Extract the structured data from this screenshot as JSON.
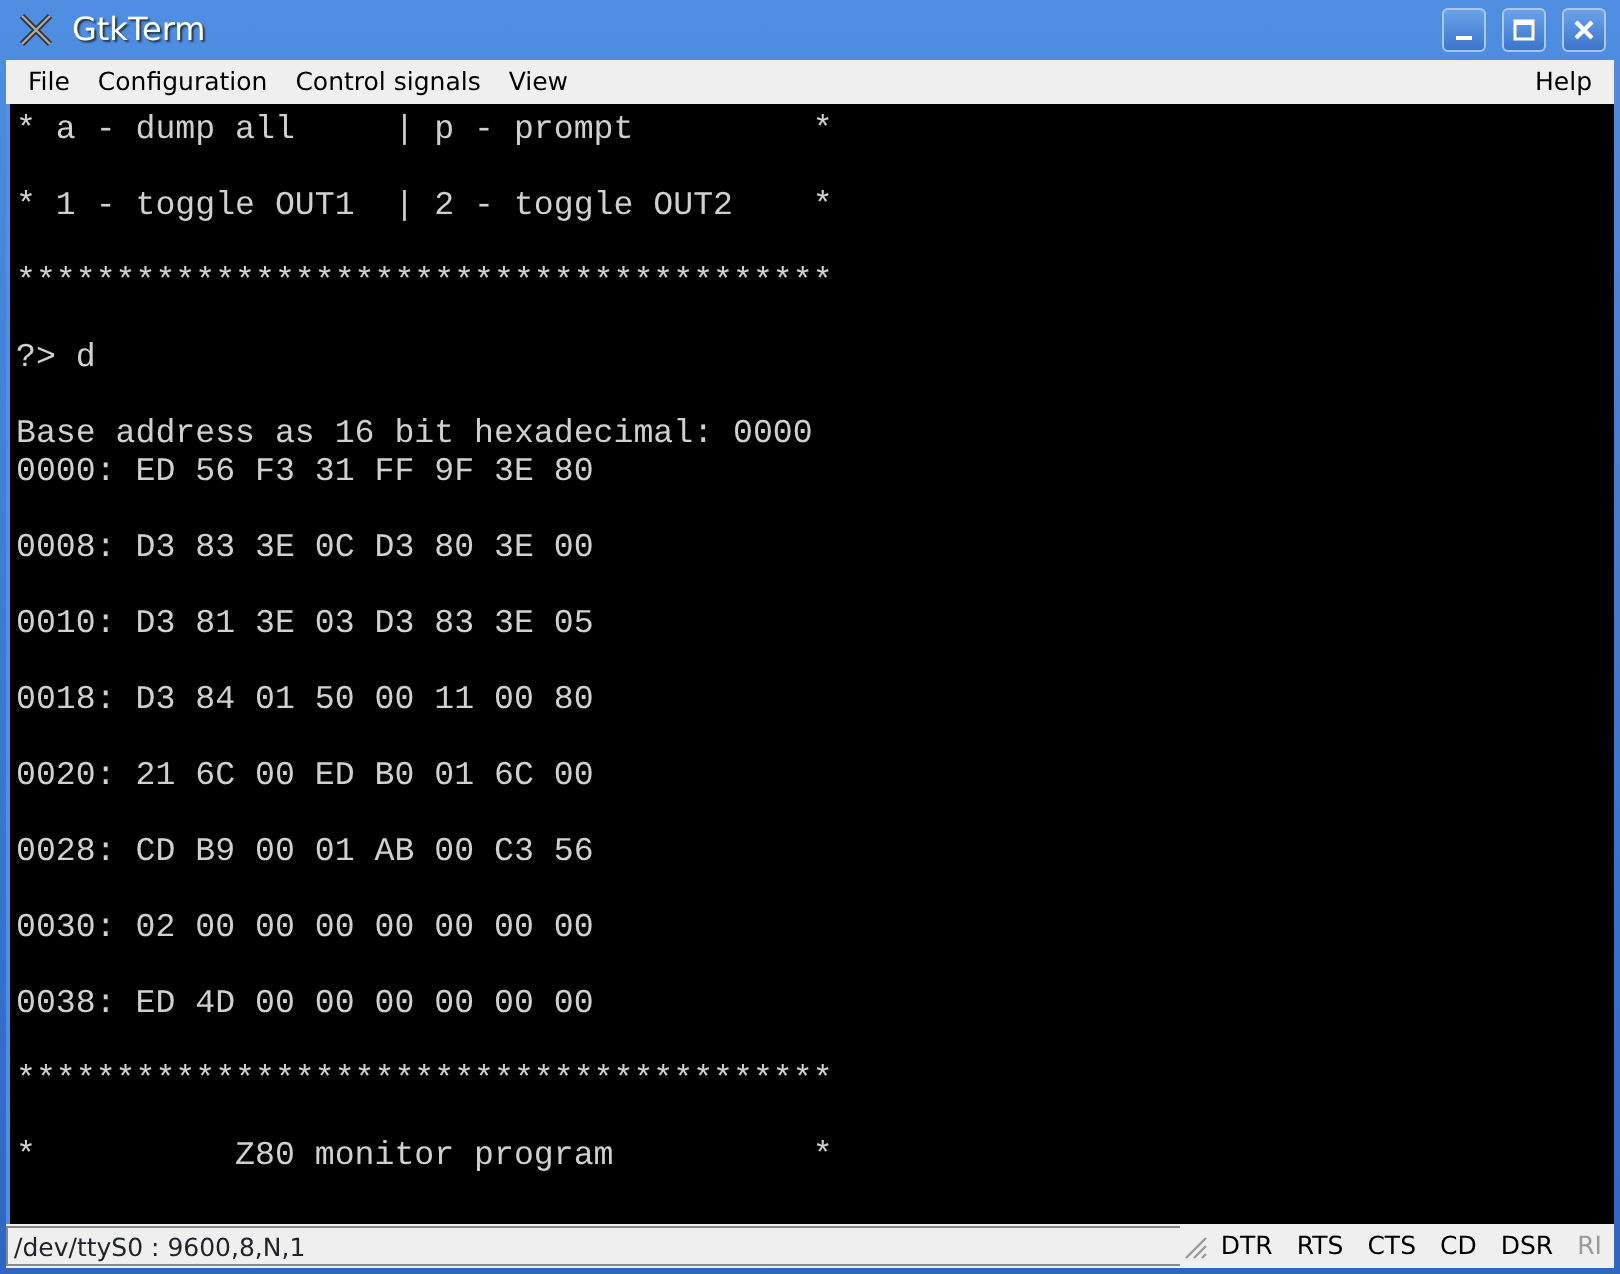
{
  "window": {
    "title": "GtkTerm"
  },
  "menu": {
    "left": [
      "File",
      "Configuration",
      "Control signals",
      "View"
    ],
    "right": [
      "Help"
    ]
  },
  "terminal": {
    "blocks": [
      [
        "* a - dump all     | p - prompt         *"
      ],
      [
        "* 1 - toggle OUT1  | 2 - toggle OUT2    *"
      ],
      [
        "*****************************************"
      ],
      [
        "?> d"
      ],
      [
        "Base address as 16 bit hexadecimal: 0000",
        "0000: ED 56 F3 31 FF 9F 3E 80"
      ],
      [
        "0008: D3 83 3E 0C D3 80 3E 00"
      ],
      [
        "0010: D3 81 3E 03 D3 83 3E 05"
      ],
      [
        "0018: D3 84 01 50 00 11 00 80"
      ],
      [
        "0020: 21 6C 00 ED B0 01 6C 00"
      ],
      [
        "0028: CD B9 00 01 AB 00 C3 56"
      ],
      [
        "0030: 02 00 00 00 00 00 00 00"
      ],
      [
        "0038: ED 4D 00 00 00 00 00 00"
      ],
      [
        "*****************************************"
      ],
      [
        "*          Z80 monitor program          *"
      ]
    ]
  },
  "status_bar": {
    "port": "/dev/ttyS0 : 9600,8,N,1",
    "signals": [
      {
        "label": "DTR",
        "active": true
      },
      {
        "label": "RTS",
        "active": true
      },
      {
        "label": "CTS",
        "active": true
      },
      {
        "label": "CD",
        "active": true
      },
      {
        "label": "DSR",
        "active": true
      },
      {
        "label": "RI",
        "active": false
      }
    ]
  }
}
